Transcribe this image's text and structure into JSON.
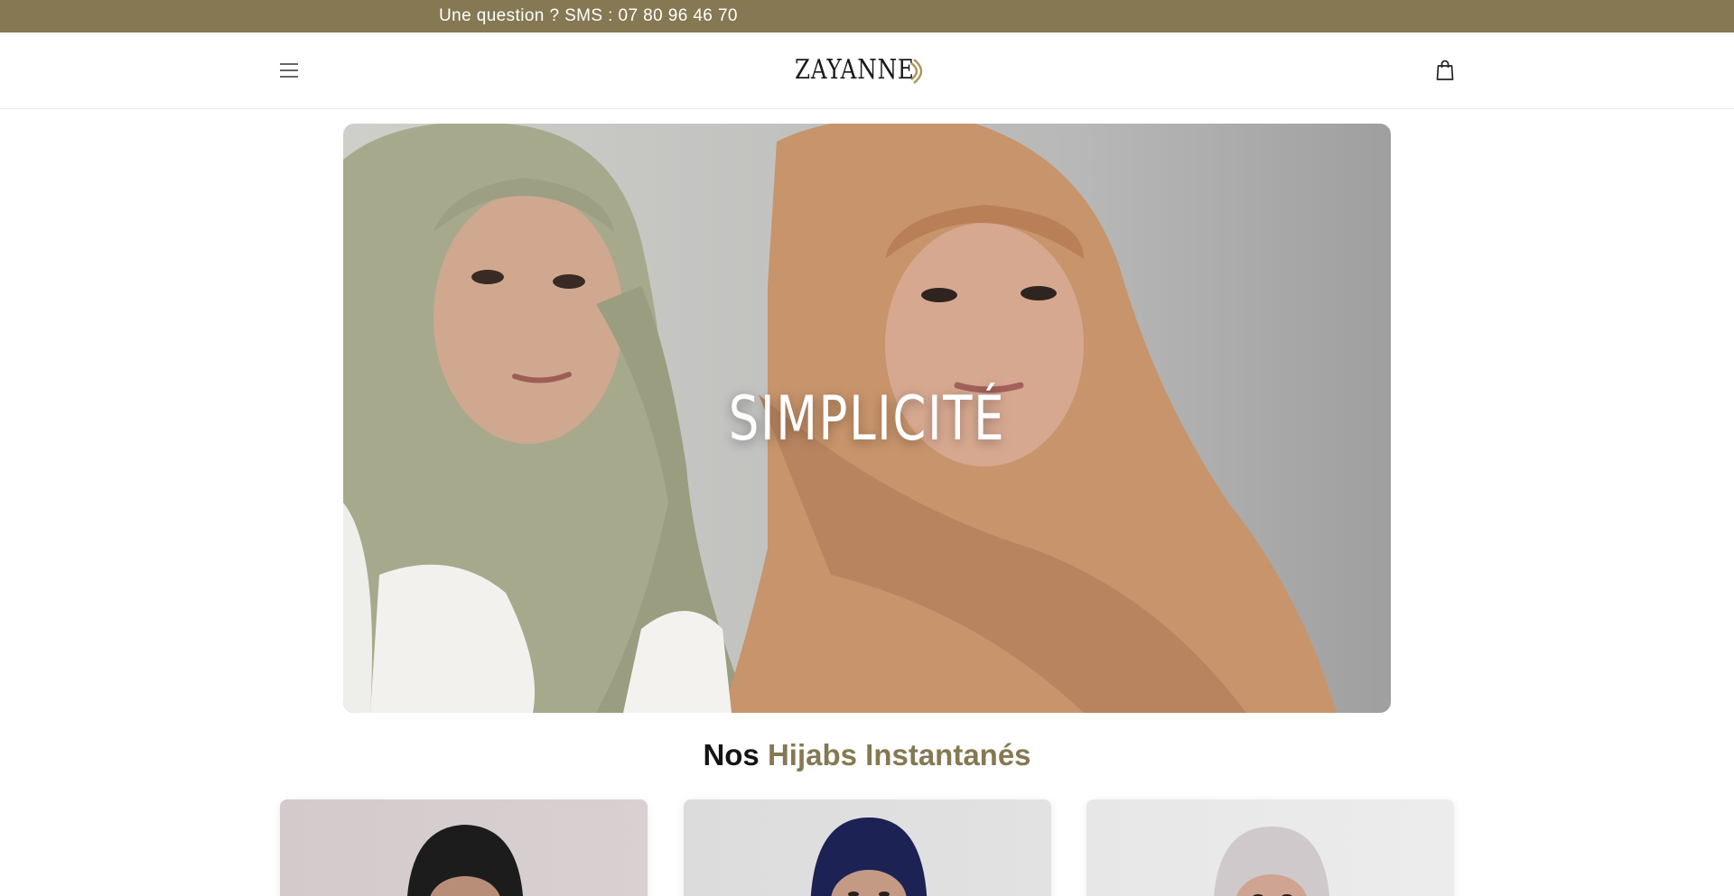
{
  "announcement": {
    "text": "Une question ? SMS : 07 80 96 46 70"
  },
  "header": {
    "logo_text": "ZAYANNE",
    "menu_icon": "hamburger-menu-icon",
    "cart_icon": "shopping-bag-icon"
  },
  "hero": {
    "title": "SIMPLICITÉ"
  },
  "section": {
    "title_strong": "Nos",
    "title_accent": "Hijabs Instantanés"
  },
  "products": [
    {
      "hijab_color": "black"
    },
    {
      "hijab_color": "navy"
    },
    {
      "hijab_color": "light grey"
    }
  ],
  "colors": {
    "accent": "#857852",
    "announcement_bg": "#857852",
    "text": "#141414",
    "background": "#ffffff"
  }
}
